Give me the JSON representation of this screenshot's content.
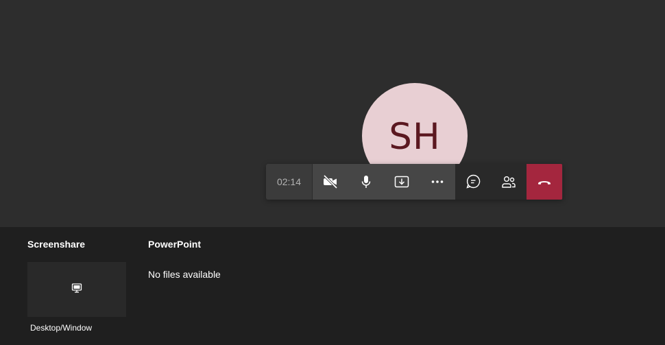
{
  "participant": {
    "initials": "SH"
  },
  "call": {
    "duration": "02:14"
  },
  "controls": [
    {
      "name": "camera-off-button",
      "icon": "camera-off-icon"
    },
    {
      "name": "microphone-button",
      "icon": "microphone-icon"
    },
    {
      "name": "share-button",
      "icon": "share-tray-icon"
    },
    {
      "name": "more-actions-button",
      "icon": "more-icon"
    },
    {
      "name": "chat-button",
      "icon": "chat-icon"
    },
    {
      "name": "participants-button",
      "icon": "people-icon"
    },
    {
      "name": "hang-up-button",
      "icon": "phone-hangup-icon"
    }
  ],
  "colors": {
    "hangup": "#a4263e",
    "avatar_bg": "#e8cfd3",
    "avatar_text": "#5b1820"
  },
  "tray": {
    "screenshare_title": "Screenshare",
    "desktop_tile_label": "Desktop/Window",
    "powerpoint_title": "PowerPoint",
    "no_files_text": "No files available"
  }
}
